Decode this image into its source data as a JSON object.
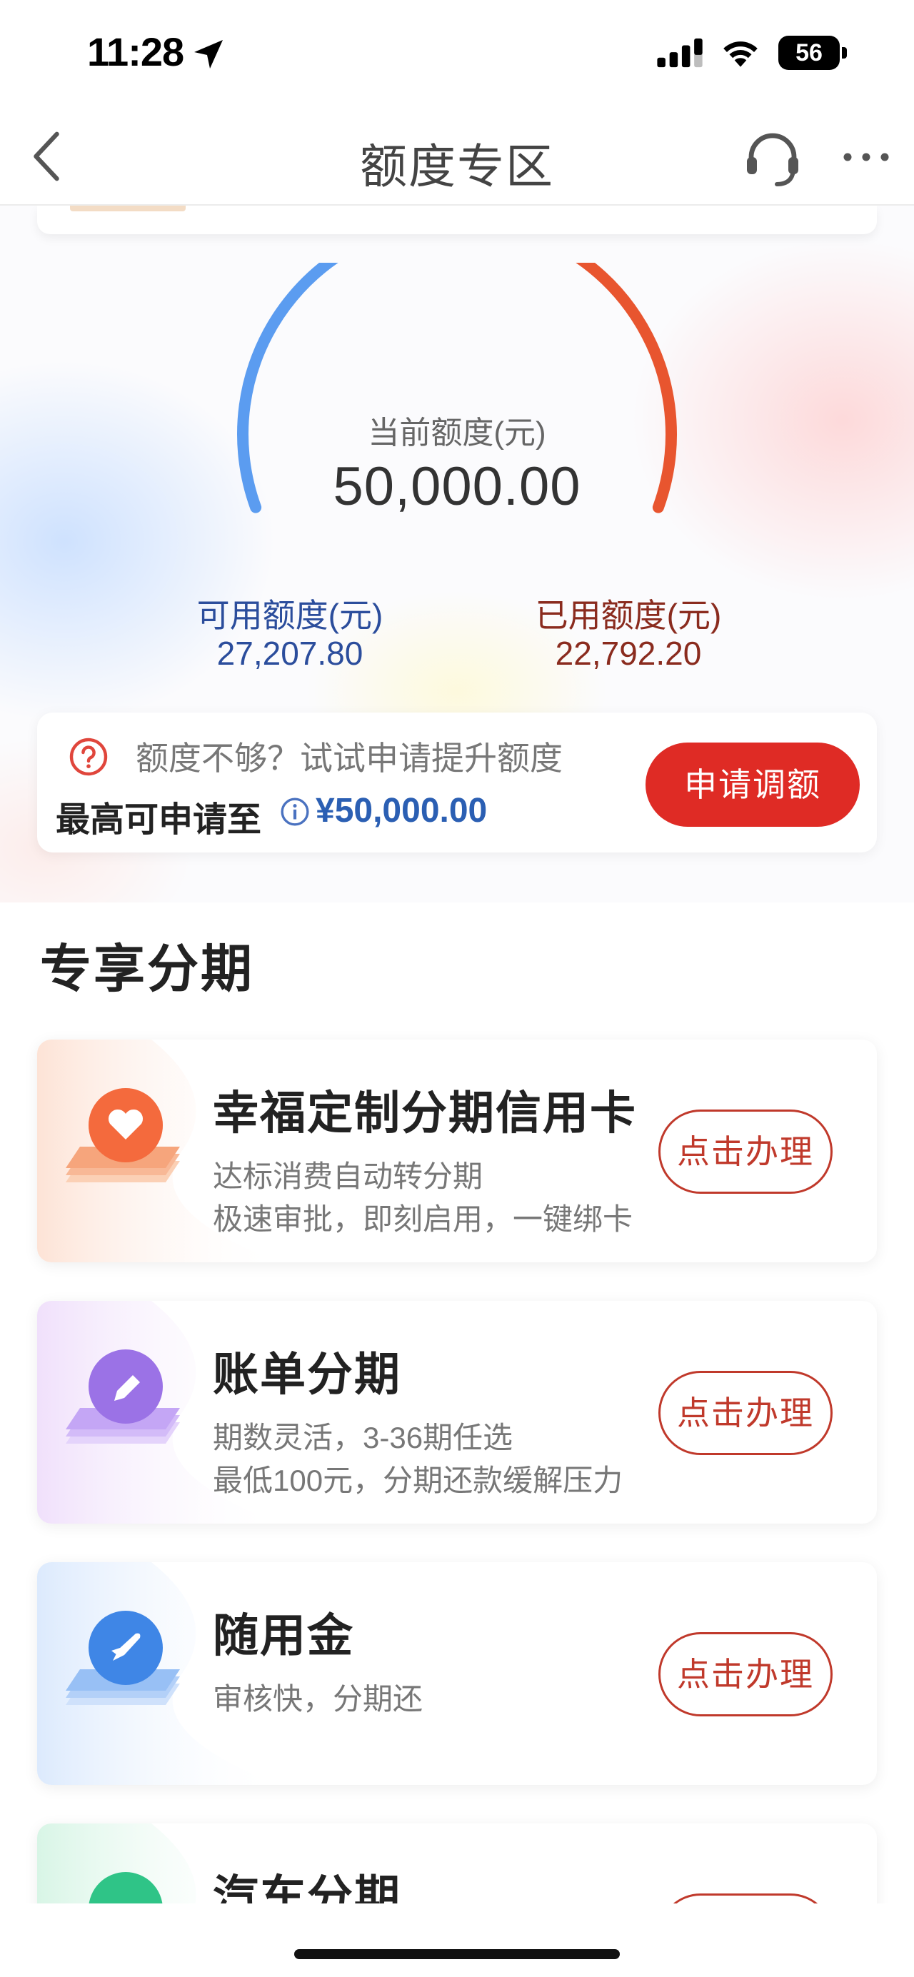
{
  "status_bar": {
    "time": "11:28",
    "battery": "56"
  },
  "nav": {
    "title": "额度专区"
  },
  "gauge": {
    "label": "当前额度(元)",
    "value": "50,000.00",
    "available_label": "可用额度(元)",
    "available_value": "27,207.80",
    "used_label": "已用额度(元)",
    "used_value": "22,792.20",
    "used_fraction": 0.4558,
    "available_color": "#5b9cf0",
    "used_color": "#e8552f"
  },
  "raise": {
    "hint": "额度不够？试试申请提升额度",
    "max_label": "最高可申请至",
    "max_value": "¥50,000.00",
    "button": "申请调额"
  },
  "section": {
    "title": "专享分期"
  },
  "offers": [
    {
      "title": "幸福定制分期信用卡",
      "desc1": "达标消费自动转分期",
      "desc2": "极速审批，即刻启用，一键绑卡",
      "button": "点击办理",
      "icon": "heart-icon"
    },
    {
      "title": "账单分期",
      "desc1": "期数灵活，3-36期任选",
      "desc2": "最低100元，分期还款缓解压力",
      "button": "点击办理",
      "icon": "pencil-icon"
    },
    {
      "title": "随用金",
      "desc1": "审核快，分期还",
      "desc2": "",
      "button": "点击办理",
      "icon": "rocket-icon"
    },
    {
      "title": "汽车分期",
      "desc1": "",
      "desc2": "",
      "button": "",
      "icon": "car-icon"
    }
  ]
}
